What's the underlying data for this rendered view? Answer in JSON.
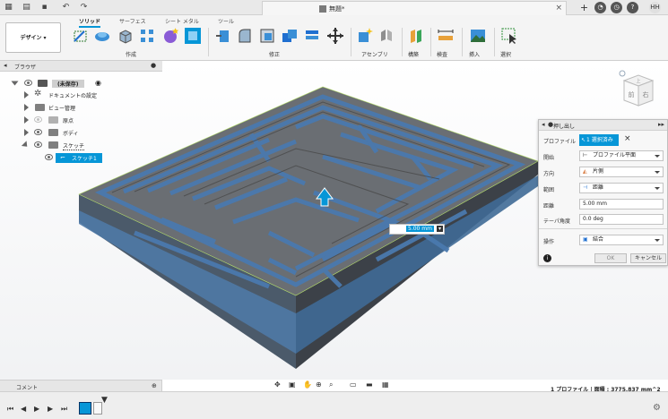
{
  "document": {
    "title": "無題*"
  },
  "user": {
    "initials": "HH"
  },
  "workspace": {
    "label": "デザイン"
  },
  "ribbon": {
    "tabs": [
      {
        "label": "ソリッド",
        "active": true
      },
      {
        "label": "サーフェス",
        "active": false
      },
      {
        "label": "シート メタル",
        "active": false
      },
      {
        "label": "ツール",
        "active": false
      }
    ],
    "groups": {
      "create": "作成",
      "modify": "修正",
      "assemble": "アセンブリ",
      "construct": "構築",
      "inspect": "検査",
      "insert": "挿入",
      "select": "選択"
    }
  },
  "browser": {
    "title": "ブラウザ",
    "items": [
      {
        "label": "(未保存)"
      },
      {
        "label": "ドキュメントの設定"
      },
      {
        "label": "ビュー管理"
      },
      {
        "label": "原点"
      },
      {
        "label": "ボディ"
      },
      {
        "label": "スケッチ"
      },
      {
        "label": "スケッチ1"
      }
    ]
  },
  "viewcube": {
    "top": "上",
    "front": "前",
    "right": "右"
  },
  "dimension_input": {
    "value": "5.00 mm"
  },
  "dialog": {
    "title": "押し出し",
    "profile_label": "プロファイル",
    "profile_value": "1 選択済み",
    "start_label": "開始",
    "start_value": "プロファイル平面",
    "direction_label": "方向",
    "direction_value": "片側",
    "extent_label": "範囲",
    "extent_value": "距離",
    "distance_label": "距離",
    "distance_value": "5.00 mm",
    "taper_label": "テーパ角度",
    "taper_value": "0.0 deg",
    "operation_label": "操作",
    "operation_value": "結合",
    "ok": "OK",
    "cancel": "キャンセル"
  },
  "comments": {
    "label": "コメント"
  },
  "status": {
    "text": "1 プロファイル | 面積 : 3775.837 mm^2"
  },
  "colors": {
    "accent": "#0696d7",
    "maze_top": "#5f5f5f",
    "maze_floor": "#4a6f97",
    "edge": "#b7e06b"
  }
}
